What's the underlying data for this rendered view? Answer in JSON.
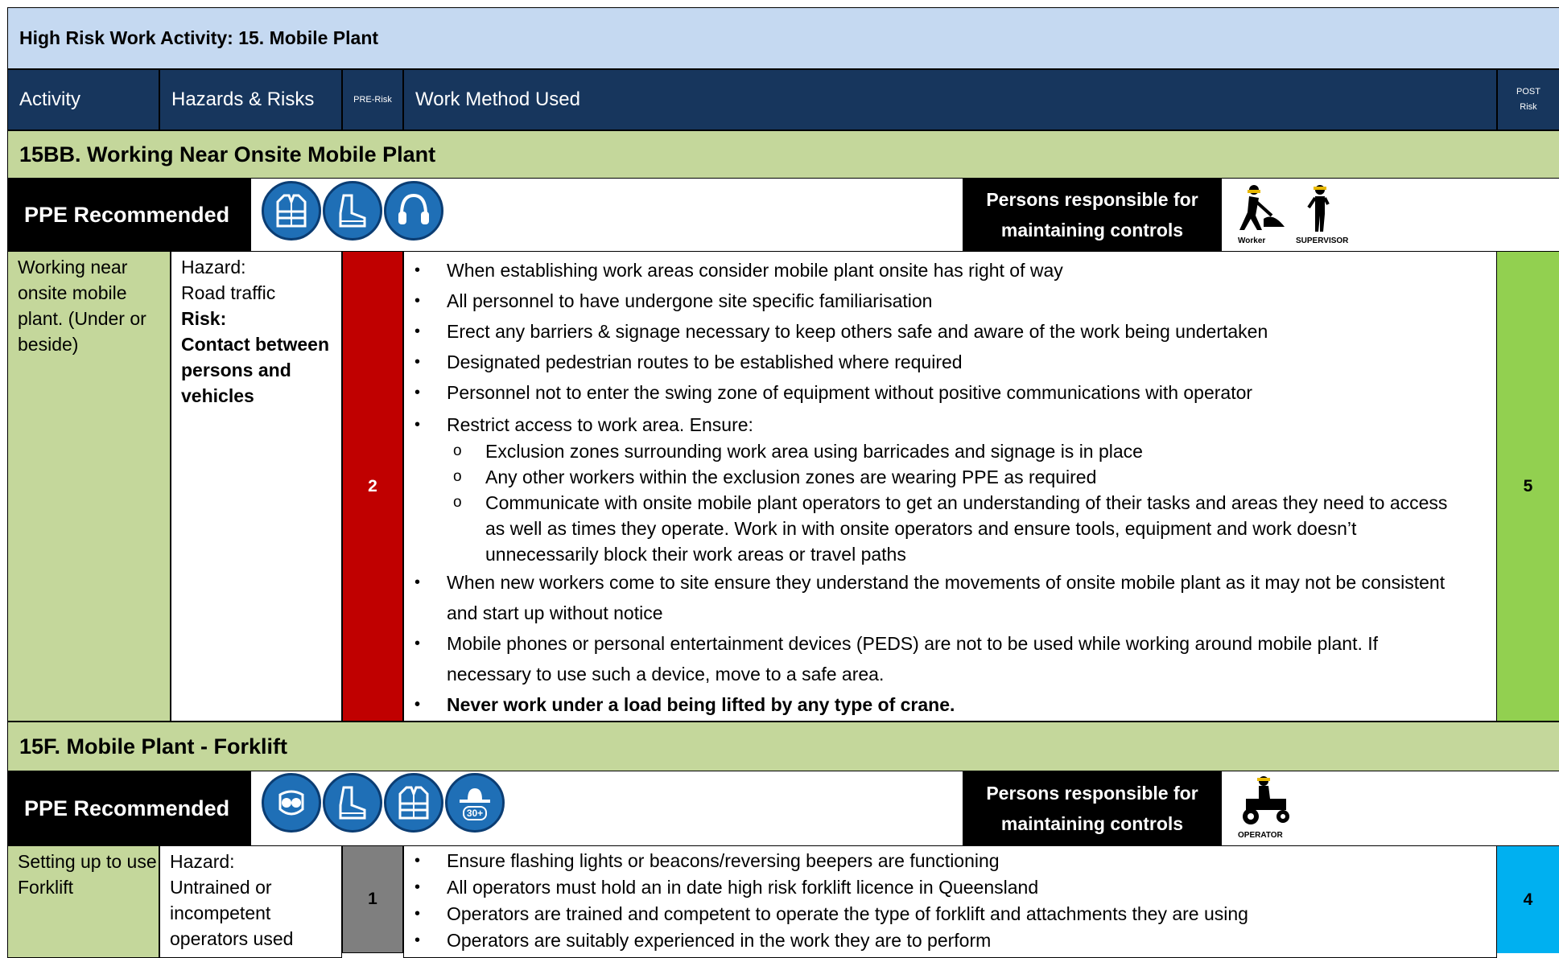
{
  "title": "High Risk Work Activity: 15. Mobile Plant",
  "header": {
    "activity": "Activity",
    "hazards": "Hazards & Risks",
    "pre_risk": "PRE-Risk",
    "work_method": "Work Method Used",
    "post_risk_line1": "POST",
    "post_risk_line2": "Risk"
  },
  "sections": [
    {
      "heading": "15BB. Working Near Onsite Mobile Plant",
      "ppe_label": "PPE Recommended",
      "ppe_icons": [
        "hi-vis-vest-icon",
        "safety-boots-icon",
        "hearing-protection-icon"
      ],
      "responsible_line1": "Persons responsible for",
      "responsible_line2": "maintaining controls",
      "responsible_icons": [
        {
          "icon": "worker-icon",
          "label": "Worker"
        },
        {
          "icon": "supervisor-icon",
          "label": "SUPERVISOR"
        }
      ],
      "activity": "Working near onsite mobile plant. (Under or beside)",
      "hazard_label": "Hazard:",
      "hazard": "Road traffic",
      "risk_label": "Risk:",
      "risk": "Contact between persons and vehicles",
      "pre_risk": "2",
      "pre_risk_color": "#c00000",
      "post_risk": "5",
      "post_risk_color": "#92d050",
      "methods": [
        "When establishing work areas consider mobile plant onsite has right of way",
        "All personnel to have undergone site specific familiarisation",
        "Erect any barriers & signage necessary to keep others safe and aware of the work being undertaken",
        "Designated pedestrian routes to be established where required",
        "Personnel not to enter the swing zone of equipment without positive communications with operator",
        "Restrict access to work area. Ensure:"
      ],
      "sub_methods": [
        "Exclusion zones surrounding work area using barricades and signage is in place",
        "Any other workers within the exclusion zones are wearing PPE as required",
        "Communicate with onsite mobile plant operators to get an understanding of their tasks and areas they need to access as well as times they operate.  Work in with onsite operators and ensure tools, equipment and work doesn’t unnecessarily block their work areas or travel paths"
      ],
      "methods_after": [
        "When new workers come to site ensure they understand the movements of onsite mobile plant as it may not be consistent and start up without notice",
        "Mobile phones or personal entertainment devices (PEDS) are not to be used while working around mobile plant. If necessary to use such a device, move to a safe area."
      ],
      "method_bold": "Never work under a load being lifted by any type of crane."
    },
    {
      "heading": "15F. Mobile Plant - Forklift",
      "ppe_label": "PPE Recommended",
      "ppe_icons": [
        "safety-glasses-icon",
        "safety-boots-icon",
        "hi-vis-vest-icon",
        "sun-protection-hat-icon"
      ],
      "sun_label": "30+",
      "responsible_line1": "Persons responsible for",
      "responsible_line2": "maintaining controls",
      "responsible_icons": [
        {
          "icon": "operator-icon",
          "label": "OPERATOR"
        }
      ],
      "activity": "Setting up to use Forklift",
      "hazard_label": "Hazard:",
      "hazard": "Untrained or incompetent operators used",
      "pre_risk": "1",
      "pre_risk_color": "#7f7f7f",
      "post_risk": "4",
      "post_risk_color": "#00b0f0",
      "methods": [
        "Ensure flashing lights or beacons/reversing beepers are functioning",
        "All operators must hold an in date high risk forklift licence in Queensland",
        "Operators are trained and competent to operate the type of forklift and attachments they are using",
        "Operators are suitably experienced in the work they are to perform"
      ]
    }
  ]
}
